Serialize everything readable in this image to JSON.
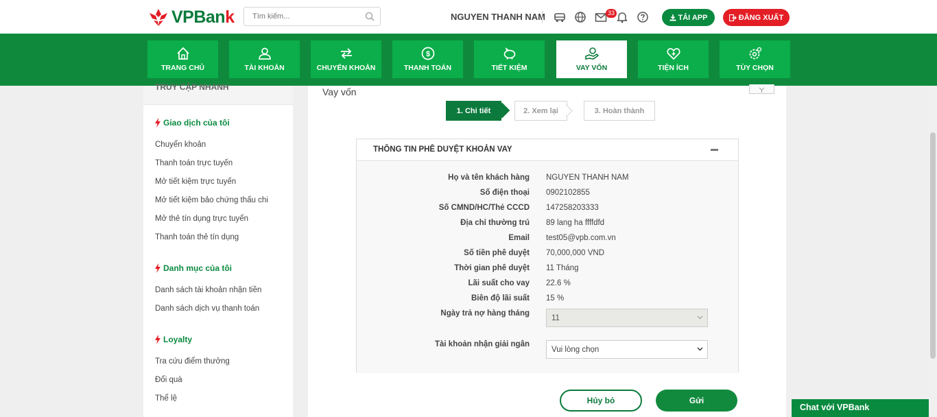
{
  "header": {
    "logo_text_main": "VPBan",
    "logo_text_end": "k",
    "search_placeholder": "Tìm kiếm...",
    "user_name": "NGUYEN THANH NAM",
    "notification_count": "33",
    "download_app_label": "TẢI APP",
    "logout_label": "ĐĂNG XUẤT"
  },
  "nav": {
    "items": [
      {
        "label": "TRANG CHỦ",
        "icon": "home-icon"
      },
      {
        "label": "TÀI KHOẢN",
        "icon": "user-icon"
      },
      {
        "label": "CHUYỂN KHOẢN",
        "icon": "transfer-icon"
      },
      {
        "label": "THANH TOÁN",
        "icon": "dollar-icon"
      },
      {
        "label": "TIẾT KIỆM",
        "icon": "piggy-bank-icon"
      },
      {
        "label": "VAY VỐN",
        "icon": "loan-icon"
      },
      {
        "label": "TIỆN ÍCH",
        "icon": "heart-plus-icon"
      },
      {
        "label": "TÙY CHỌN",
        "icon": "settings-icon"
      }
    ],
    "active_index": 5
  },
  "sidebar": {
    "header": "TRUY CẬP NHANH",
    "sections": [
      {
        "title": "Giao dịch của tôi",
        "links": [
          "Chuyển khoản",
          "Thanh toán trực tuyến",
          "Mở tiết kiệm trực tuyến",
          "Mở tiết kiệm bảo chứng thấu chi",
          "Mở thẻ tín dụng trực tuyến",
          "Thanh toán thẻ tín dụng"
        ]
      },
      {
        "title": "Danh mục của tôi",
        "links": [
          "Danh sách tài khoản nhận tiền",
          "Danh sách dịch vụ thanh toán"
        ]
      },
      {
        "title": "Loyalty",
        "links": [
          "Tra cứu điểm thưởng",
          "Đổi quà",
          "Thể lệ"
        ]
      }
    ]
  },
  "main": {
    "title": "Vay vốn",
    "steps": [
      "1. Chi tiết",
      "2. Xem lại",
      "3. Hoàn thành"
    ],
    "panel_title": "THÔNG TIN PHÊ DUYỆT KHOẢN VAY",
    "fields": [
      {
        "label": "Họ và tên khách hàng",
        "value": "NGUYEN THANH NAM"
      },
      {
        "label": "Số điện thoại",
        "value": "0902102855"
      },
      {
        "label": "Số CMND/HC/Thẻ CCCD",
        "value": "147258203333"
      },
      {
        "label": "Địa chỉ thường trú",
        "value": "89 lang ha ffffdfd"
      },
      {
        "label": "Email",
        "value": "test05@vpb.com.vn"
      },
      {
        "label": "Số tiền phê duyệt",
        "value": "70,000,000 VND"
      },
      {
        "label": "Thời gian phê duyệt",
        "value": "11 Tháng"
      },
      {
        "label": "Lãi suất cho vay",
        "value": "22.6 %"
      },
      {
        "label": "Biên độ lãi suất",
        "value": "15 %"
      }
    ],
    "repay_day_label": "Ngày trả nợ hàng tháng",
    "repay_day_value": "11",
    "disburse_account_label": "Tài khoản nhận giải ngân",
    "disburse_account_value": "Vui lòng chọn",
    "cancel_label": "Hủy bỏ",
    "submit_label": "Gửi"
  },
  "chat": {
    "label": "Chat với VPBank"
  },
  "colors": {
    "brand_green": "#0a8a3f",
    "nav_green": "#0f8a3d",
    "tile_green": "#0bae4a",
    "brand_red": "#e31d25"
  }
}
